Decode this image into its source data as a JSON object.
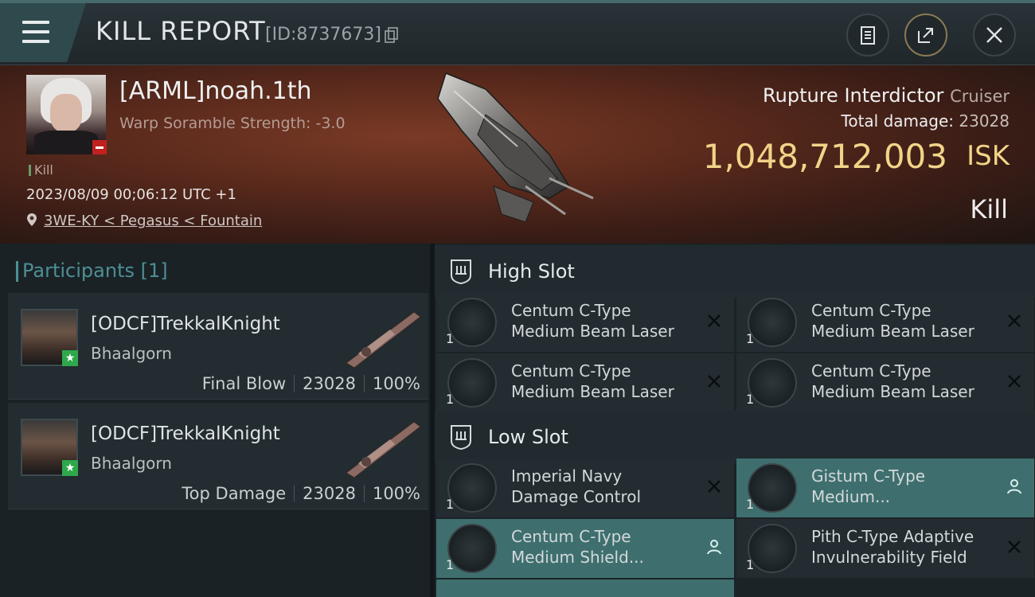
{
  "header": {
    "menu_icon": "hamburger-icon",
    "title": "KILL REPORT",
    "report_id": "[ID:8737673]",
    "copy_icon": "copy-icon",
    "buttons": [
      {
        "name": "clipboard-icon"
      },
      {
        "name": "share-icon"
      },
      {
        "name": "close-icon"
      }
    ]
  },
  "victim": {
    "name": "[ARML]noah.1th",
    "warp_scramble": "Warp Soramble Strength: -3.0",
    "tag": "Kill",
    "datetime": "2023/08/09 00;06:12 UTC +1",
    "location": "3WE-KY < Pegasus < Fountain",
    "ship_name": "Rupture Interdictor",
    "ship_class": "Cruiser",
    "total_damage_label": "Total damage:",
    "total_damage": "23028",
    "isk_value": "1,048,712,003",
    "isk_label": "ISK",
    "result": "Kill"
  },
  "participants": {
    "title": "Participants [1]",
    "items": [
      {
        "name": "[ODCF]TrekkalKnight",
        "ship": "Bhaalgorn",
        "role": "Final Blow",
        "damage": "23028",
        "percent": "100%"
      },
      {
        "name": "[ODCF]TrekkalKnight",
        "ship": "Bhaalgorn",
        "role": "Top Damage",
        "damage": "23028",
        "percent": "100%"
      }
    ]
  },
  "fitting": {
    "high_slot_label": "High Slot",
    "low_slot_label": "Low Slot",
    "high_slot": [
      {
        "line1": "Centum C-Type",
        "line2": "Medium Beam Laser",
        "qty": "1",
        "status": "destroyed"
      },
      {
        "line1": "Centum C-Type",
        "line2": "Medium Beam Laser",
        "qty": "1",
        "status": "destroyed"
      },
      {
        "line1": "Centum C-Type",
        "line2": "Medium Beam Laser",
        "qty": "1",
        "status": "destroyed"
      },
      {
        "line1": "Centum C-Type",
        "line2": "Medium Beam Laser",
        "qty": "1",
        "status": "destroyed"
      }
    ],
    "low_slot": [
      {
        "line1": "Imperial Navy",
        "line2": "Damage Control",
        "qty": "1",
        "status": "destroyed"
      },
      {
        "line1": "Gistum C-Type",
        "line2": "Medium...",
        "qty": "1",
        "status": "dropped"
      },
      {
        "line1": "Centum C-Type",
        "line2": "Medium Shield...",
        "qty": "1",
        "status": "dropped"
      },
      {
        "line1": "Pith C-Type Adaptive",
        "line2": "Invulnerability Field",
        "qty": "1",
        "status": "destroyed"
      }
    ]
  },
  "colors": {
    "isk": "#f1d488",
    "accent": "#4d8f93",
    "dropped_highlight": "#3e6f6e"
  }
}
